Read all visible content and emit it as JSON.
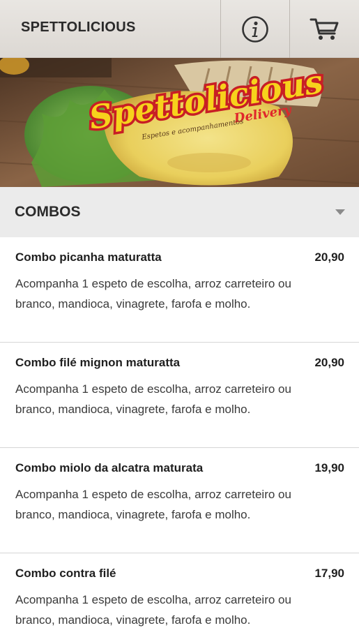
{
  "header": {
    "title": "SPETTOLICIOUS",
    "info_icon": "info-icon",
    "cart_icon": "cart-icon"
  },
  "banner": {
    "logo_text": "Spettolicious",
    "logo_sub": "Delivery",
    "tagline": "Espetos e acompanhamentos"
  },
  "category": {
    "label": "COMBOS",
    "toggle_icon": "caret-down-icon"
  },
  "items": [
    {
      "name": "Combo picanha maturatta",
      "price": "20,90",
      "desc": "Acompanha 1 espeto de escolha, arroz carreteiro ou branco, mandioca, vinagrete, farofa e molho."
    },
    {
      "name": "Combo filé mignon maturatta",
      "price": "20,90",
      "desc": "Acompanha 1 espeto de escolha, arroz carreteiro ou branco, mandioca, vinagrete, farofa e molho."
    },
    {
      "name": "Combo miolo da alcatra maturata",
      "price": "19,90",
      "desc": "Acompanha 1 espeto de escolha, arroz carreteiro ou branco, mandioca, vinagrete, farofa e molho."
    },
    {
      "name": "Combo contra filé",
      "price": "17,90",
      "desc": "Acompanha 1 espeto de escolha, arroz carreteiro ou branco, mandioca, vinagrete, farofa e molho."
    }
  ],
  "colors": {
    "logo_red": "#e0262b",
    "logo_yellow": "#f7d21c",
    "header_bg": "#e4e0dc",
    "category_bg": "#ebebeb"
  }
}
